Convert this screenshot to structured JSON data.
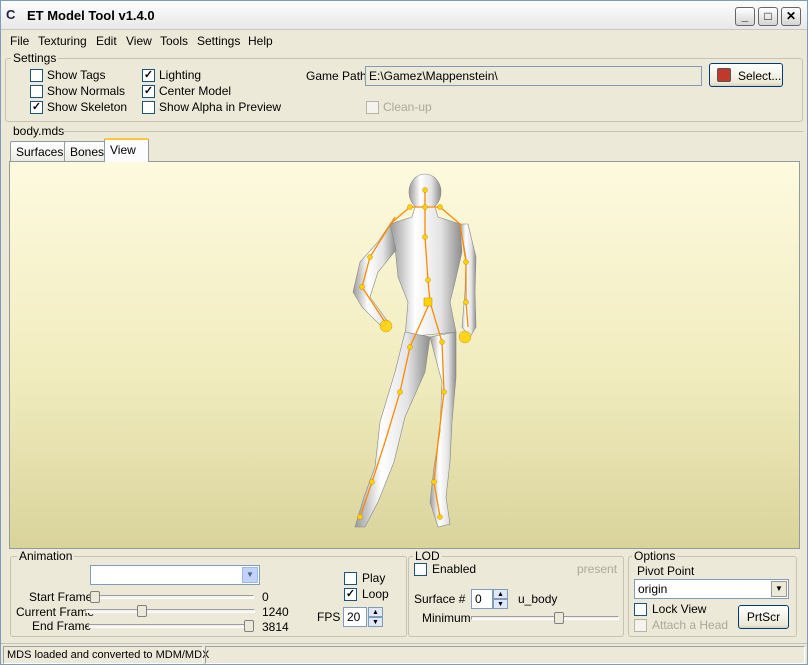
{
  "window": {
    "title": "ET Model Tool v1.4.0",
    "controls": [
      "_",
      "□",
      "✕"
    ]
  },
  "menu": [
    "File",
    "Texturing",
    "Edit",
    "View",
    "Tools",
    "Settings",
    "Help"
  ],
  "settings": {
    "label": "Settings",
    "show_tags": {
      "label": "Show Tags",
      "checked": false
    },
    "show_normals": {
      "label": "Show Normals",
      "checked": false
    },
    "show_skeleton": {
      "label": "Show Skeleton",
      "checked": true
    },
    "lighting": {
      "label": "Lighting",
      "checked": true
    },
    "center_model": {
      "label": "Center Model",
      "checked": true
    },
    "show_alpha": {
      "label": "Show Alpha in Preview",
      "checked": false
    },
    "game_path_label": "Game Path",
    "game_path_value": "E:\\Gamez\\Mappenstein\\",
    "select_button": "Select...",
    "cleanup": {
      "label": "Clean-up",
      "checked": false,
      "disabled": true
    }
  },
  "file_label": "body.mds",
  "tabs": [
    {
      "label": "Surfaces",
      "active": false
    },
    {
      "label": "Bones",
      "active": false
    },
    {
      "label": "View",
      "active": true
    }
  ],
  "animation": {
    "label": "Animation",
    "combo_value": "",
    "start_frame_label": "Start Frame",
    "start_frame_value": "0",
    "start_frame_pos": 0,
    "current_frame_label": "Current Frame",
    "current_frame_value": "1240",
    "current_frame_pos": 0.325,
    "end_frame_label": "End Frame",
    "end_frame_value": "3814",
    "end_frame_pos": 1,
    "play": {
      "label": "Play",
      "checked": false
    },
    "loop": {
      "label": "Loop",
      "checked": true
    },
    "fps_label": "FPS",
    "fps_value": "20"
  },
  "lod": {
    "label": "LOD",
    "enabled": {
      "label": "Enabled",
      "checked": false
    },
    "present_label": "present",
    "surface_label": "Surface #",
    "surface_value": "0",
    "surface_name": "u_body",
    "minimum_label": "Minimum",
    "minimum_pos": 0.6
  },
  "options": {
    "label": "Options",
    "pivot_label": "Pivot Point",
    "pivot_value": "origin",
    "lock_view": {
      "label": "Lock View",
      "checked": false
    },
    "attach_head": {
      "label": "Attach a Head",
      "checked": false,
      "disabled": true
    },
    "prtscr_button": "PrtScr"
  },
  "status": {
    "text": "MDS loaded and converted to MDM/MDX"
  },
  "colors": {
    "skeleton": "#ff8a00",
    "joint": "#ffd200",
    "viewport_top": "#fdfadf",
    "viewport_bottom": "#d9d39b"
  }
}
